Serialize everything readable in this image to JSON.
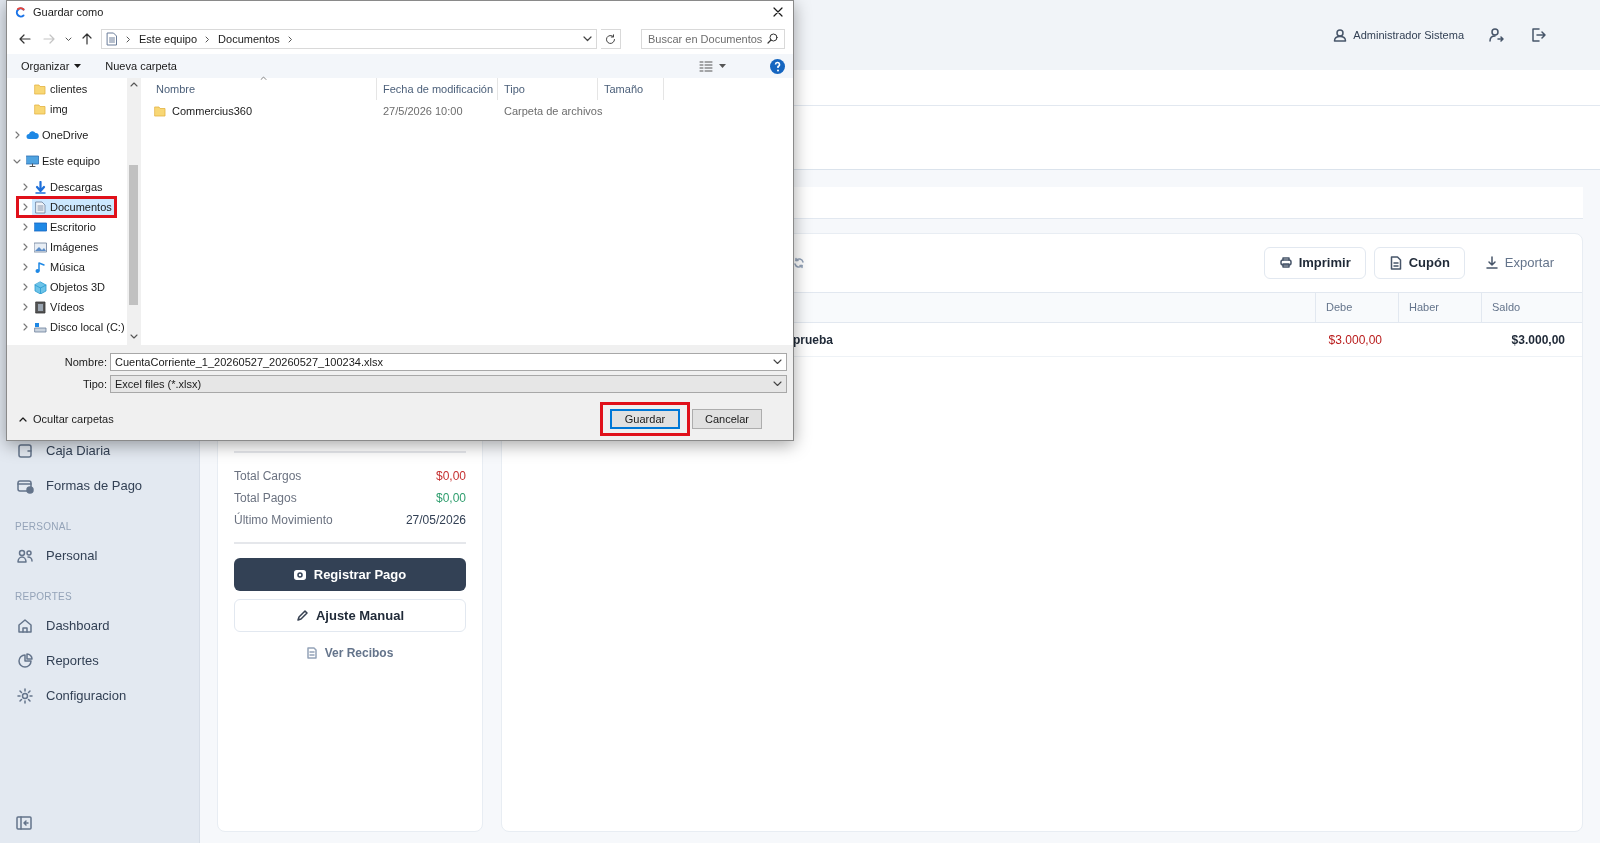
{
  "dialog": {
    "title": "Guardar como",
    "breadcrumb": [
      "Este equipo",
      "Documentos"
    ],
    "search_placeholder": "Buscar en Documentos",
    "toolbar": {
      "organize": "Organizar",
      "new_folder": "Nueva carpeta"
    },
    "nav_tree": {
      "partial_children": [
        {
          "label": "clientes",
          "kind": "folder"
        },
        {
          "label": "img",
          "kind": "folder"
        }
      ],
      "items": [
        {
          "label": "OneDrive",
          "kind": "cloud",
          "expanded": false,
          "selected": false,
          "highlighted": false
        },
        {
          "label": "Este equipo",
          "kind": "pc",
          "expanded": true,
          "selected": false,
          "highlighted": false,
          "children": [
            {
              "label": "Descargas",
              "kind": "download",
              "expanded": false,
              "selected": false,
              "highlighted": false
            },
            {
              "label": "Documentos",
              "kind": "documents",
              "expanded": false,
              "selected": true,
              "highlighted": true
            },
            {
              "label": "Escritorio",
              "kind": "desktop",
              "expanded": false,
              "selected": false,
              "highlighted": false
            },
            {
              "label": "Imágenes",
              "kind": "pictures",
              "expanded": false,
              "selected": false,
              "highlighted": false
            },
            {
              "label": "Música",
              "kind": "music",
              "expanded": false,
              "selected": false,
              "highlighted": false
            },
            {
              "label": "Objetos 3D",
              "kind": "objects",
              "expanded": false,
              "selected": false,
              "highlighted": false
            },
            {
              "label": "Vídeos",
              "kind": "videos",
              "expanded": false,
              "selected": false,
              "highlighted": false
            },
            {
              "label": "Disco local (C:)",
              "kind": "drive",
              "expanded": false,
              "selected": false,
              "highlighted": false
            }
          ]
        }
      ]
    },
    "columns": [
      "Nombre",
      "Fecha de modificación",
      "Tipo",
      "Tamaño"
    ],
    "files": [
      {
        "name": "Commercius360",
        "modified": "27/5/2026 10:00",
        "type": "Carpeta de archivos"
      }
    ],
    "filename_label": "Nombre:",
    "filename": "CuentaCorriente_1_20260527_20260527_100234.xlsx",
    "type_label": "Tipo:",
    "type": "Excel files (*.xlsx)",
    "hide_folders": "Ocultar carpetas",
    "buttons": [
      {
        "label": "Guardar",
        "kind": "default",
        "highlighted": true
      },
      {
        "label": "Cancelar",
        "kind": "normal",
        "highlighted": false
      }
    ]
  },
  "header": {
    "user": "Administrador Sistema"
  },
  "sidebar": {
    "items": [
      {
        "kind": "item",
        "label": "Caja Diaria"
      },
      {
        "kind": "item",
        "label": "Formas de Pago"
      },
      {
        "kind": "section",
        "label": "PERSONAL"
      },
      {
        "kind": "item",
        "label": "Personal"
      },
      {
        "kind": "section",
        "label": "REPORTES"
      },
      {
        "kind": "item",
        "label": "Dashboard"
      },
      {
        "kind": "item",
        "label": "Reportes"
      },
      {
        "kind": "item",
        "label": "Configuracion"
      }
    ]
  },
  "summary": [
    {
      "label": "Total Cargos",
      "value": "$0,00",
      "color": "#c53030"
    },
    {
      "label": "Total Pagos",
      "value": "$0,00",
      "color": "#2f9e6e"
    },
    {
      "label": "Último Movimiento",
      "value": "27/05/2026",
      "color": "#334155"
    }
  ],
  "actions": [
    {
      "label": "Registrar Pago",
      "kind": "primary"
    },
    {
      "label": "Ajuste Manual",
      "kind": "outline"
    },
    {
      "label": "Ver Recibos",
      "kind": "link"
    }
  ],
  "toolbar_buttons": [
    {
      "label": "Imprimir",
      "kind": "outline"
    },
    {
      "label": "Cupón",
      "kind": "outline"
    },
    {
      "label": "Exportar",
      "kind": "plain"
    }
  ],
  "table": {
    "columns": [
      "Debe",
      "Haber",
      "Saldo"
    ],
    "rows": [
      {
        "column_1": "prueba",
        "debe": "$3.000,00",
        "saldo": "$3.000,00"
      }
    ]
  }
}
